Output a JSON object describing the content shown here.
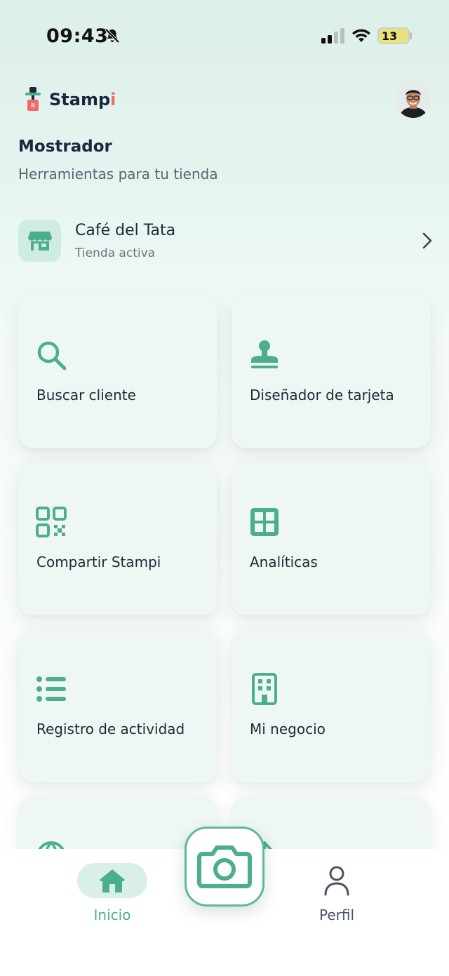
{
  "status_bar": {
    "time": "09:43",
    "battery": "13"
  },
  "header": {
    "brand_main": "Stamp",
    "brand_accent": "i",
    "avatar_icon": "user-avatar"
  },
  "page": {
    "title": "Mostrador",
    "subtitle": "Herramientas para tu tienda"
  },
  "store": {
    "name": "Café del Tata",
    "status": "Tienda activa",
    "icon": "store-icon"
  },
  "tools": [
    {
      "label": "Buscar cliente",
      "icon": "search-icon"
    },
    {
      "label": "Diseñador de tarjeta",
      "icon": "stamp-icon"
    },
    {
      "label": "Compartir Stampi",
      "icon": "qr-code-icon"
    },
    {
      "label": "Analíticas",
      "icon": "grid-icon"
    },
    {
      "label": "Registro de actividad",
      "icon": "list-icon"
    },
    {
      "label": "Mi negocio",
      "icon": "building-icon"
    }
  ],
  "bottom_nav": {
    "home_label": "Inicio",
    "profile_label": "Perfil",
    "camera_icon": "camera-icon"
  },
  "colors": {
    "accent": "#4caf8c",
    "card_bg": "#eef7f3",
    "title": "#1a2740",
    "brand_accent": "#ef6a6a"
  }
}
